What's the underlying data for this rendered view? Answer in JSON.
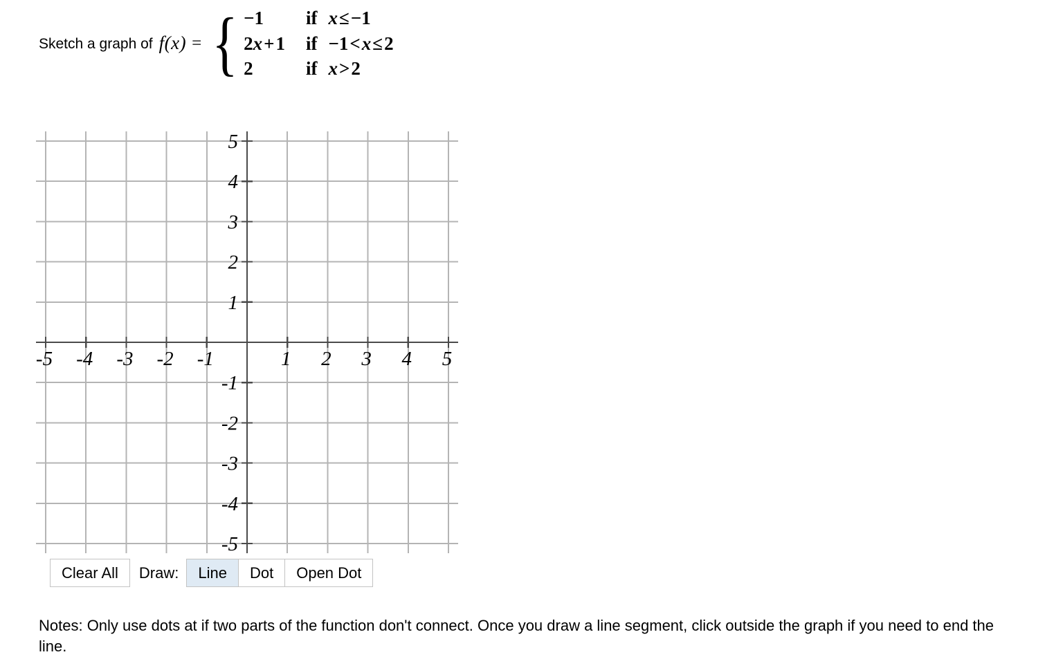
{
  "prompt": {
    "lead_text": "Sketch a graph of",
    "function_label": "f(x)",
    "equals": "=",
    "pieces": [
      {
        "expression": "−1",
        "if": "if",
        "condition_lhs": "x",
        "condition_op": "≤",
        "condition_rhs": "−1",
        "condition_full": "x ≤ −1"
      },
      {
        "expression": "2x + 1",
        "if": "if",
        "condition_lhs": "−1 < x",
        "condition_op": "≤",
        "condition_rhs": "2",
        "condition_full": "−1 < x ≤ 2"
      },
      {
        "expression": "2",
        "if": "if",
        "condition_lhs": "x",
        "condition_op": ">",
        "condition_rhs": "2",
        "condition_full": "x > 2"
      }
    ]
  },
  "graph": {
    "x_axis": {
      "min": -5,
      "max": 5,
      "tick_labels": [
        "-5",
        "-4",
        "-3",
        "-2",
        "-1",
        "1",
        "2",
        "3",
        "4",
        "5"
      ],
      "tick_values": [
        -5,
        -4,
        -3,
        -2,
        -1,
        1,
        2,
        3,
        4,
        5
      ]
    },
    "y_axis": {
      "min": -5,
      "max": 5,
      "tick_labels": [
        "5",
        "4",
        "3",
        "2",
        "1",
        "-1",
        "-2",
        "-3",
        "-4",
        "-5"
      ],
      "tick_values": [
        5,
        4,
        3,
        2,
        1,
        -1,
        -2,
        -3,
        -4,
        -5
      ]
    },
    "grid_color": "#b4b4b4",
    "axis_color": "#4a4a4a",
    "label_color": "#000000",
    "plotted_curves": []
  },
  "toolbar": {
    "clear_all_label": "Clear All",
    "draw_label": "Draw:",
    "modes": [
      {
        "label": "Line",
        "selected": true
      },
      {
        "label": "Dot",
        "selected": false
      },
      {
        "label": "Open Dot",
        "selected": false
      }
    ],
    "selected_color": "#dfeaf4"
  },
  "notes": {
    "text": "Notes: Only use dots at if two parts of the function don't connect. Once you draw a line segment, click outside the graph if you need to end the line."
  }
}
